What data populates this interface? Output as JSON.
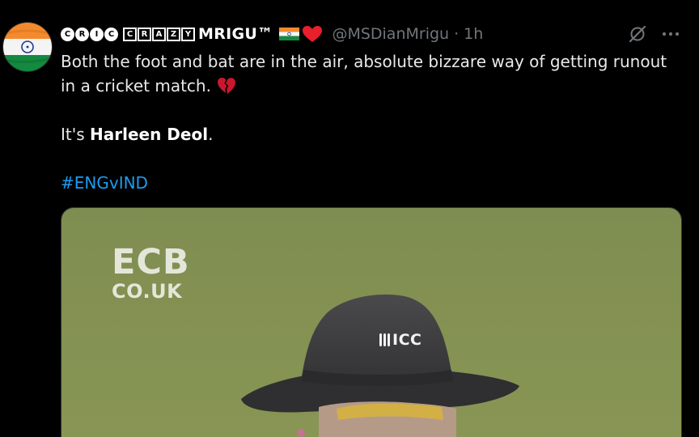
{
  "tweet": {
    "author": {
      "name_glyphs_circle": [
        "C",
        "R",
        "I",
        "C"
      ],
      "name_glyphs_square": [
        "C",
        "R",
        "A",
        "Z",
        "Y"
      ],
      "name_tail": "MRIGU™",
      "handle": "@MSDianMrigu",
      "separator": "·",
      "time": "1h",
      "avatar_icon": "india-flag-avatar",
      "badge_icons": [
        "india-flag-icon",
        "red-heart-icon"
      ]
    },
    "text": {
      "line1": "Both the foot and bat are in the air, absolute bizzare way of getting runout",
      "line2": "in a cricket match.",
      "line2_emoji": "broken-heart-icon",
      "line3_prefix": "It's ",
      "line3_bold": "Harleen Deol",
      "line3_suffix": ".",
      "hashtag": "#ENGvIND"
    },
    "media": {
      "watermark_top": "ECB",
      "watermark_bottom": "CO.UK",
      "hat_logo": "ICC",
      "description_colors": {
        "field": "#7d8c4f",
        "hat": "#3b3b3d"
      }
    },
    "actions": {
      "grok_icon": "grok-slash-icon",
      "more_icon": "more-dots-icon"
    }
  }
}
